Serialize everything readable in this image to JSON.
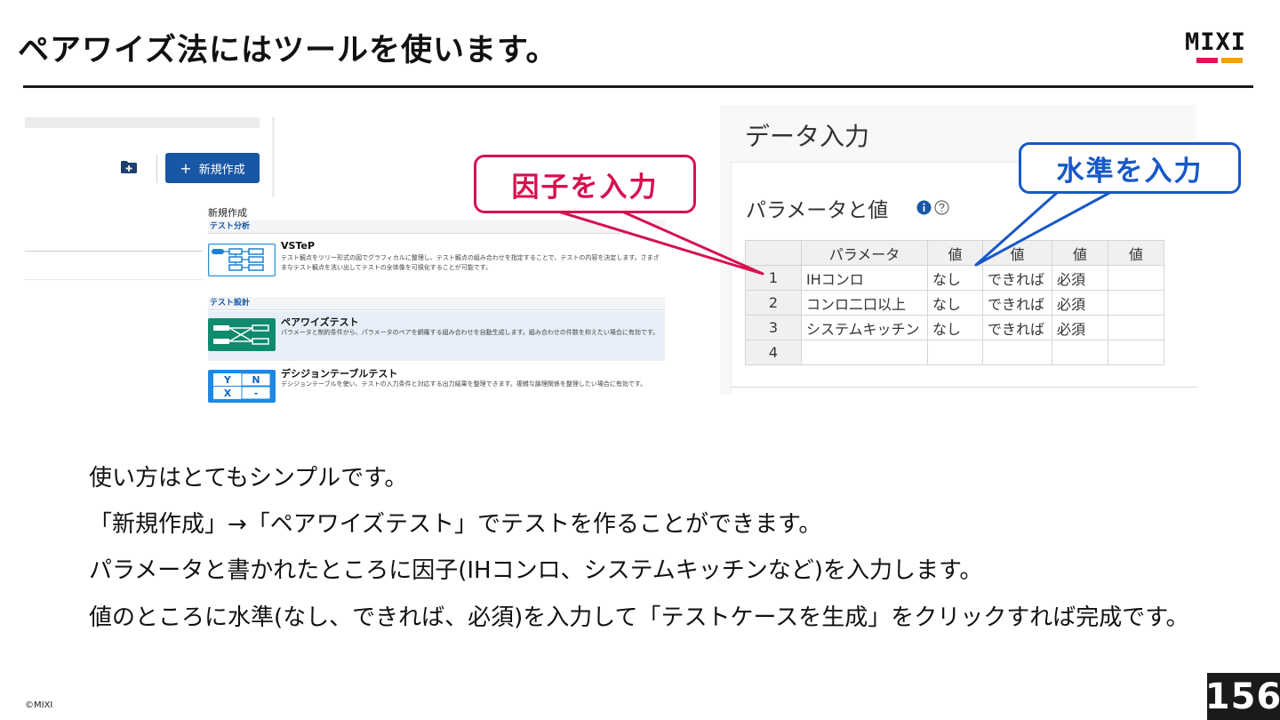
{
  "slide": {
    "title": "ペアワイズ法にはツールを使います。",
    "logo_text": "MIXI",
    "copyright": "©MIXI",
    "page_number": "156"
  },
  "colors": {
    "accent_red": "#d6114f",
    "accent_blue": "#1758c7",
    "button_blue": "#1857a6",
    "logo_magenta": "#e4145a",
    "logo_orange": "#f5a01a"
  },
  "tool_left": {
    "folder_icon": "folder-plus-icon",
    "new_button": {
      "icon": "+",
      "label": "新規作成"
    },
    "menu": {
      "title": "新規作成",
      "sections": [
        {
          "header": "テスト分析",
          "items": [
            {
              "name": "VSTeP",
              "icon": "tree-diagram-icon",
              "description": "テスト観点をツリー形式の図でグラフィカルに整理し、テスト観点の組み合わせを指定することで、テストの内容を決定します。さまざまなテスト観点を洗い出してテストの全体像を可視化することが可能です。"
            }
          ]
        },
        {
          "header": "テスト設計",
          "items": [
            {
              "name": "ペアワイズテスト",
              "icon": "pairwise-icon",
              "description": "パラメータと制約条件から、パラメータのペアを網羅する組み合わせを自動生成します。組み合わせの件数を抑えたい場合に有効です。",
              "highlighted": true
            },
            {
              "name": "デシジョンテーブルテスト",
              "icon": "decision-table-icon",
              "description": "デシジョンテーブルを使い、テストの入力条件と対応する出力結果を整理できます。複雑な論理関係を整理したい場合に有効です。",
              "icon_cells": [
                "Y",
                "N",
                "X",
                "-"
              ]
            }
          ]
        }
      ]
    }
  },
  "tool_right": {
    "title": "データ入力",
    "subtitle": "パラメータと値",
    "table": {
      "headers": [
        "",
        "パラメータ",
        "値",
        "値",
        "値",
        "値"
      ],
      "rows": [
        [
          "1",
          "IHコンロ",
          "なし",
          "できれば",
          "必須",
          ""
        ],
        [
          "2",
          "コンロ二口以上",
          "なし",
          "できれば",
          "必須",
          ""
        ],
        [
          "3",
          "システムキッチン",
          "なし",
          "できれば",
          "必須",
          ""
        ],
        [
          "4",
          "",
          "",
          "",
          "",
          ""
        ]
      ]
    }
  },
  "callouts": {
    "factor": "因子を入力",
    "level": "水準を入力"
  },
  "body": {
    "lines": [
      "使い方はとてもシンプルです。",
      "「新規作成」→「ペアワイズテスト」でテストを作ることができます。",
      "パラメータと書かれたところに因子(IHコンロ、システムキッチンなど)を入力します。",
      "値のところに水準(なし、できれば、必須)を入力して「テストケースを生成」をクリックすれば完成です。"
    ]
  }
}
